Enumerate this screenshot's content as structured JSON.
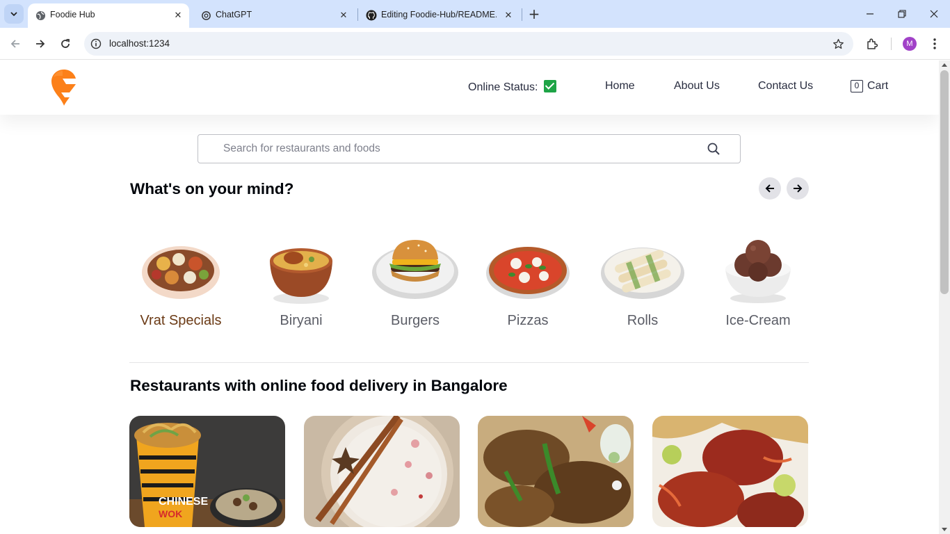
{
  "browser": {
    "tabs": [
      {
        "title": "Foodie Hub",
        "active": true,
        "favicon": "globe-icon"
      },
      {
        "title": "ChatGPT",
        "active": false,
        "favicon": "openai-icon"
      },
      {
        "title": "Editing Foodie-Hub/README.m",
        "active": false,
        "favicon": "github-icon"
      }
    ],
    "url": "localhost:1234",
    "profile_initial": "M"
  },
  "header": {
    "online_status_label": "Online Status:",
    "online_status_value": "online",
    "nav": {
      "home": "Home",
      "about": "About Us",
      "contact": "Contact Us",
      "cart_label": "Cart",
      "cart_count": "0"
    }
  },
  "search": {
    "placeholder": "Search for restaurants and foods"
  },
  "mind": {
    "title": "What's on your mind?",
    "categories": [
      {
        "label": "Vrat Specials",
        "icon": "thali-plate-image"
      },
      {
        "label": "Biryani",
        "icon": "biryani-bowl-image"
      },
      {
        "label": "Burgers",
        "icon": "burger-image"
      },
      {
        "label": "Pizzas",
        "icon": "pizza-image"
      },
      {
        "label": "Rolls",
        "icon": "rolls-image"
      },
      {
        "label": "Ice-Cream",
        "icon": "ice-cream-image"
      }
    ]
  },
  "restaurants": {
    "title": "Restaurants with online food delivery in Bangalore",
    "cards": [
      {
        "image": "noodles-box-image"
      },
      {
        "image": "kheer-bowl-image"
      },
      {
        "image": "grilled-chicken-rice-image"
      },
      {
        "image": "tandoori-chicken-image"
      }
    ]
  },
  "colors": {
    "brand_orange": "#fc8019",
    "text_dark": "#282c3f",
    "online_green": "#1ea446"
  }
}
